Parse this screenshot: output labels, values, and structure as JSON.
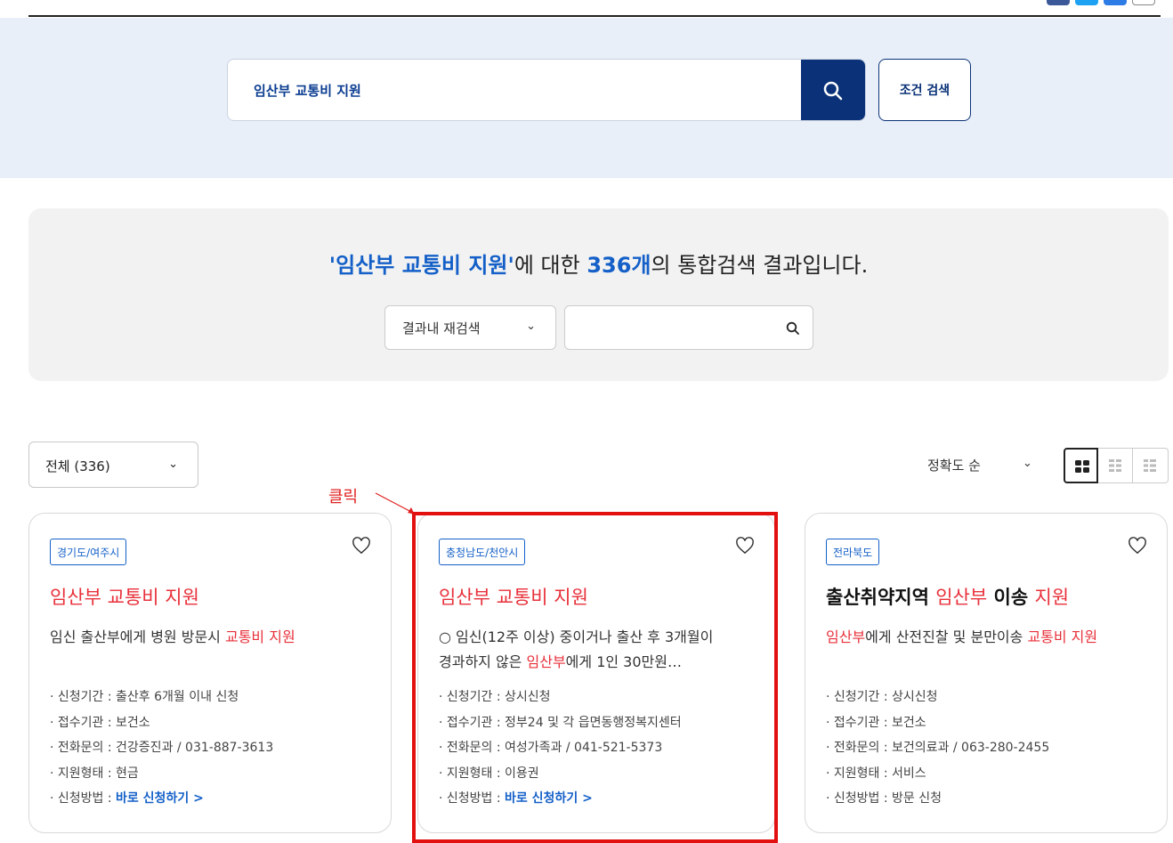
{
  "search": {
    "query": "임산부 교통비 지원",
    "condition_button": "조건 검색"
  },
  "summary": {
    "prefix": "'임산부 교통비 지원'",
    "mid": "에 대한 ",
    "count": "336개",
    "suffix": "의 통합검색 결과입니다.",
    "rescope_label": "결과내 재검색",
    "rescope_input": ""
  },
  "filter": {
    "category": "전체 (336)",
    "sort": "정확도 순"
  },
  "annotation": {
    "label": "클릭"
  },
  "cards": [
    {
      "tag": "경기도/여주시",
      "title": "임산부 교통비 지원",
      "desc_plain": "임신 출산부에게 병원 방문시 ",
      "desc_red": "교통비 지원",
      "meta": {
        "period": "신청기간 : 출산후 6개월 이내 신청",
        "agency": "접수기관 : 보건소",
        "phone": "전화문의 : 건강증진과 / 031-887-3613",
        "type": "지원형태 : 현금",
        "method_label": "신청방법 : ",
        "method_link": "바로 신청하기 >"
      }
    },
    {
      "tag": "충청남도/천안시",
      "title": "임산부 교통비 지원",
      "desc_line1": "○ 임신(12주 이상) 중이거나 출산 후 3개월이",
      "desc_line2a": "경과하지 않은 ",
      "desc_line2red": "임산부",
      "desc_line2b": "에게 1인 30만원…",
      "meta": {
        "period": "신청기간 : 상시신청",
        "agency": "접수기관 : 정부24 및 각 읍면동행정복지센터",
        "phone": "전화문의 : 여성가족과 / 041-521-5373",
        "type": "지원형태 : 이용권",
        "method_label": "신청방법 : ",
        "method_link": "바로 신청하기 >"
      }
    },
    {
      "tag": "전라북도",
      "title_a": "출산취약지역 ",
      "title_b": "임산부",
      "title_c": " 이송 ",
      "title_d": "지원",
      "desc_red1": "임산부",
      "desc_plain": "에게 산전진찰 및 분만이송 ",
      "desc_red2": "교통비 지원",
      "meta": {
        "period": "신청기간 : 상시신청",
        "agency": "접수기관 : 보건소",
        "phone": "전화문의 : 보건의료과 / 063-280-2455",
        "type": "지원형태 : 서비스",
        "method": "신청방법 : 방문 신청"
      }
    }
  ],
  "colors": {
    "primary": "#0b3278",
    "highlight": "#1460c8",
    "keyword": "#e8303a",
    "annotation": "#e31010"
  },
  "icons": [
    "search-icon",
    "heart-icon",
    "chevron-down-icon",
    "grid-view-icon",
    "list-view-icon"
  ]
}
